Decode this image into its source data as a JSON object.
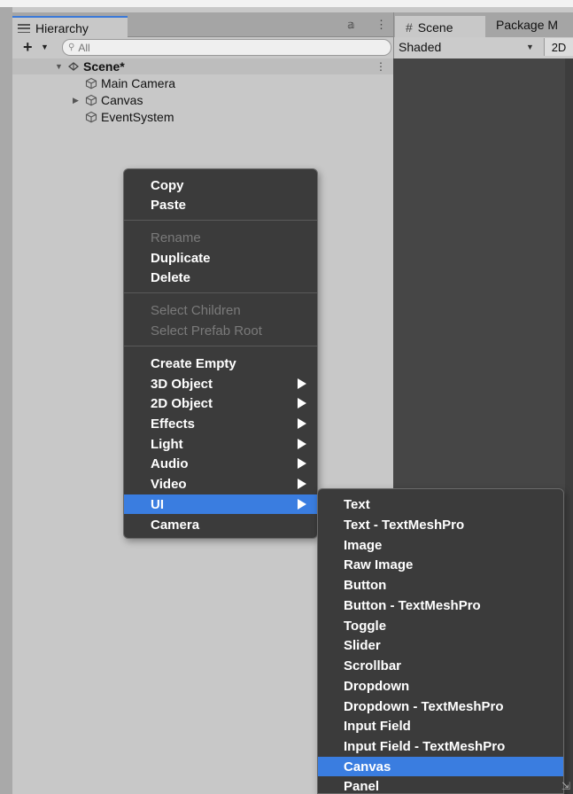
{
  "hierarchy": {
    "tab_label": "Hierarchy",
    "add_label": "+",
    "search_placeholder": "All",
    "scene": {
      "name": "Scene*"
    },
    "items": [
      {
        "label": "Main Camera"
      },
      {
        "label": "Canvas"
      },
      {
        "label": "EventSystem"
      }
    ]
  },
  "scene_panel": {
    "tab_label": "Scene",
    "package_tab_label": "Package M",
    "shading_mode": "Shaded",
    "mode_2d": "2D"
  },
  "context_menu": {
    "copy": "Copy",
    "paste": "Paste",
    "rename": "Rename",
    "duplicate": "Duplicate",
    "delete": "Delete",
    "select_children": "Select Children",
    "select_prefab_root": "Select Prefab Root",
    "create_empty": "Create Empty",
    "object_3d": "3D Object",
    "object_2d": "2D Object",
    "effects": "Effects",
    "light": "Light",
    "audio": "Audio",
    "video": "Video",
    "ui": "UI",
    "camera": "Camera"
  },
  "ui_submenu": {
    "items": [
      "Text",
      "Text - TextMeshPro",
      "Image",
      "Raw Image",
      "Button",
      "Button - TextMeshPro",
      "Toggle",
      "Slider",
      "Scrollbar",
      "Dropdown",
      "Dropdown - TextMeshPro",
      "Input Field",
      "Input Field - TextMeshPro",
      "Canvas",
      "Panel"
    ]
  },
  "colors": {
    "highlight": "#3a7de0",
    "menu_bg": "#3b3b3b",
    "panel_bg": "#c8c8c8",
    "viewport_bg": "#464646"
  }
}
